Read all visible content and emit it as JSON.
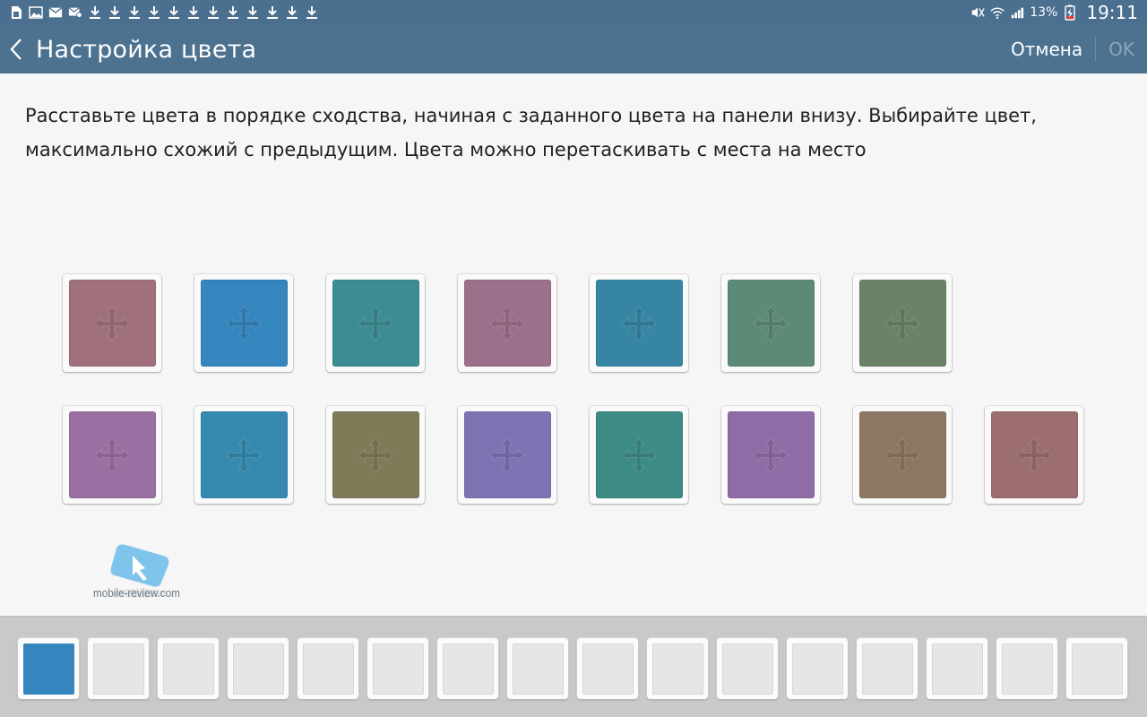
{
  "status_bar": {
    "battery_percent": "13%",
    "time": "19:11",
    "left_icons": [
      "sim-icon",
      "image-icon",
      "mail-icon",
      "mail-settings-icon",
      "download-icon",
      "download-icon",
      "download-icon",
      "download-icon",
      "download-icon",
      "download-icon",
      "download-icon",
      "download-icon",
      "download-icon",
      "download-icon",
      "download-icon",
      "download-icon"
    ]
  },
  "action_bar": {
    "title": "Настройка цвета",
    "cancel_label": "Отмена",
    "ok_label": "OK"
  },
  "instructions": "Расставьте цвета в порядке сходства, начиная с заданного цвета на панели внизу. Выбирайте цвет, максимально схожий с предыдущим. Цвета можно перетаскивать с места на место",
  "tiles": {
    "row1": [
      "#a0707d",
      "#3585bf",
      "#3b8c93",
      "#9c6f8b",
      "#3685a3",
      "#5d8a77",
      "#6a8367"
    ],
    "row2": [
      "#9a6fa1",
      "#368aaf",
      "#7f7a58",
      "#7e72b3",
      "#3d8b85",
      "#8f6ca6",
      "#8d7762",
      "#9c6e6e"
    ]
  },
  "bottom_palette": {
    "filled_slot_color": "#3585bf",
    "slot_count": 16
  },
  "watermark": {
    "text": "mobile-review.com"
  }
}
